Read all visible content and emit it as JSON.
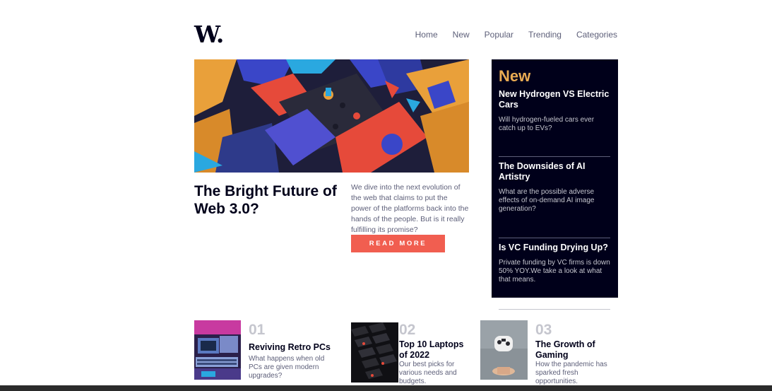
{
  "logo": "W.",
  "nav": [
    "Home",
    "New",
    "Popular",
    "Trending",
    "Categories"
  ],
  "hero": {
    "title": "The Bright Future of Web 3.0?",
    "description": "We dive into the next evolution of the web that claims to put the power of the platforms back into the hands of the people. But is it really fulfilling its promise?",
    "button": "READ MORE"
  },
  "new_section": {
    "heading": "New",
    "items": [
      {
        "title": "New Hydrogen VS Electric Cars",
        "desc": "Will hydrogen-fueled cars ever catch up to EVs?"
      },
      {
        "title": "The Downsides of AI Artistry",
        "desc": "What are the possible adverse effects of on-demand AI image generation?"
      },
      {
        "title": "Is VC Funding Drying Up?",
        "desc": "Private funding by VC firms is down 50% YOY.We take a look at what that means."
      }
    ]
  },
  "articles": [
    {
      "num": "01",
      "title": "Reviving Retro PCs",
      "desc": "What happens when old PCs are given modern upgrades?"
    },
    {
      "num": "02",
      "title": "Top 10 Laptops of 2022",
      "desc": "Our best picks for various needs and budgets."
    },
    {
      "num": "03",
      "title": "The Growth of Gaming",
      "desc": "How the pandemic has sparked fresh opportunities."
    }
  ],
  "colors": {
    "accent_red": "#f15e50",
    "accent_orange": "#e9ab53",
    "dark_navy": "#00001a",
    "grayish_blue": "#5d5f79"
  }
}
